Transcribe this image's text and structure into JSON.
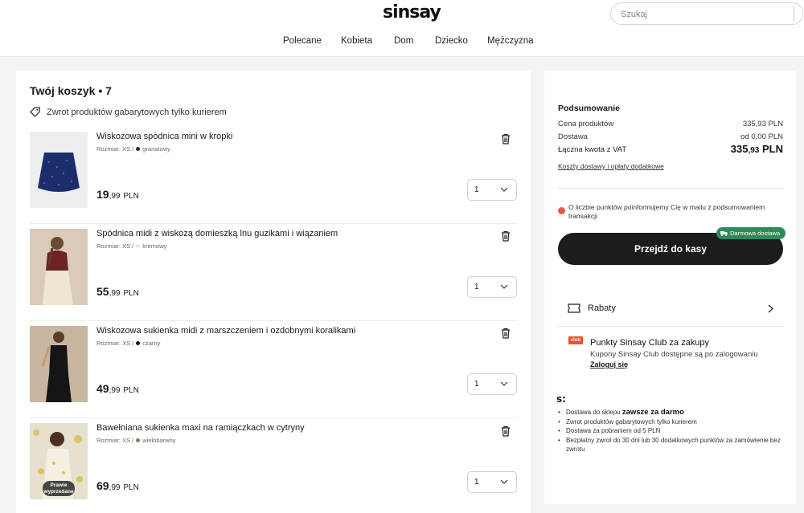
{
  "header": {
    "logo": "sinsay",
    "search_placeholder": "Szukaj",
    "nav": [
      "Polecane",
      "Kobieta",
      "Dom",
      "Dziecko",
      "Mężczyzna"
    ]
  },
  "cart": {
    "title": "Twój koszyk • 7",
    "return_note": "Zwrot produktów gabarytowych tylko kurierem",
    "items": [
      {
        "name": "Wiskozowa spódnica mini w kropki",
        "size": "Rozmiar: XS /",
        "color_name": "granatowy",
        "color": "#1f2a4f",
        "price_int": "19",
        "price_dec": ",99",
        "currency": "PLN",
        "qty": "1"
      },
      {
        "name": "Spódnica midi z wiskozą domieszką lnu guzikami i wiązaniem",
        "size": "Rozmiar: XS /",
        "color_name": "kremowy",
        "color": "#efe6d0",
        "price_int": "55",
        "price_dec": ",99",
        "currency": "PLN",
        "qty": "1"
      },
      {
        "name": "Wiskozowa sukienka midi z marszczeniem i ozdobnymi koralikami",
        "size": "Rozmiar: XS /",
        "color_name": "czarny",
        "color": "#111111",
        "price_int": "49",
        "price_dec": ",99",
        "currency": "PLN",
        "qty": "1"
      },
      {
        "name": "Bawełniana sukienka maxi na ramiączkach w cytryny",
        "size": "Rozmiar: XS /",
        "color_name": "wielobarwny",
        "color": "#8a7a5a",
        "price_int": "69",
        "price_dec": ",99",
        "currency": "PLN",
        "qty": "1",
        "badge": "Prawie wyprzedane"
      }
    ]
  },
  "summary": {
    "title": "Podsumowanie",
    "products_label": "Cena produktów",
    "products_value": "335,93 PLN",
    "delivery_label": "Dostawa",
    "delivery_value": "od 0,00 PLN",
    "total_label": "Łączna kwota z VAT",
    "total_int": "335",
    "total_dec": ",93",
    "total_cur": "PLN",
    "costs_link": "Koszty dostawy i opłaty dodatkowe",
    "points_note": "O liczbie punktów poinformujemy Cię w mailu z podsumowaniem transakcji",
    "free_delivery_badge": "Darmowa dostawa",
    "checkout_label": "Przejdź do kasy",
    "discounts_label": "Rabaty",
    "club_logo": "club",
    "club_title": "Punkty Sinsay Club za zakupy",
    "club_sub": "Kupony Sinsay Club dostępne są po zalogowaniu",
    "club_login": "Zaloguj się",
    "mark": "s:",
    "benefits": [
      {
        "pre": "Dostawa do sklepu ",
        "bold": "zawsze za darmo"
      },
      {
        "pre": "Zwrot produktów gabarytowych tylko kurierem",
        "bold": ""
      },
      {
        "pre": "Dostawa za pobraniem od 5 PLN",
        "bold": ""
      },
      {
        "pre": "Bezpłatny zwrot do 30 dni lub 30 dodatkowych punktów za zamówienie bez zwrotu",
        "bold": ""
      }
    ]
  },
  "colors": {
    "accent_dark": "#1c1c1c",
    "free_badge": "#2e8b57",
    "club": "#e8522e",
    "info_icon": "#e85a3c"
  }
}
